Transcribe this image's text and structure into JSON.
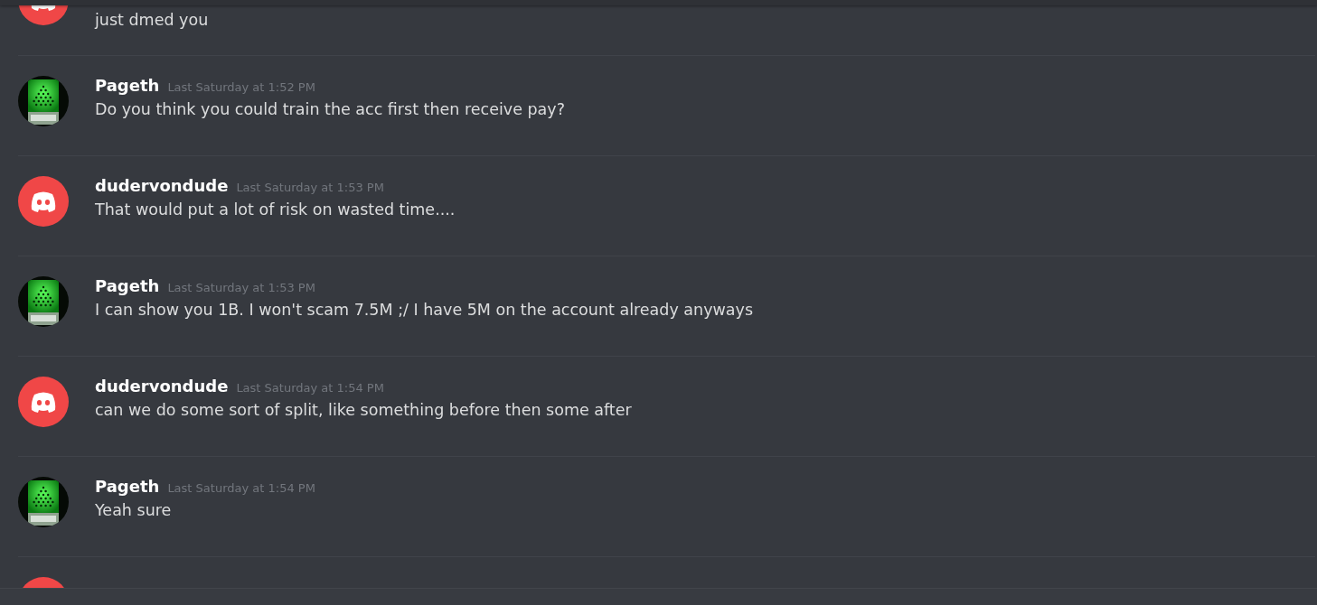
{
  "messages": [
    {
      "kind": "logo",
      "text": "just dmed you"
    },
    {
      "kind": "picture",
      "author": "Pageth",
      "timestamp": "Last Saturday at 1:52 PM",
      "text": "Do you think you could train the acc first then receive pay?"
    },
    {
      "kind": "logo",
      "author": "dudervondude",
      "timestamp": "Last Saturday at 1:53 PM",
      "text": "That would put a lot of risk on wasted time...."
    },
    {
      "kind": "picture",
      "author": "Pageth",
      "timestamp": "Last Saturday at 1:53 PM",
      "text": "I can show you 1B. I won't scam 7.5M ;/ I have 5M on the account already anyways"
    },
    {
      "kind": "logo",
      "author": "dudervondude",
      "timestamp": "Last Saturday at 1:54 PM",
      "text": "can we do some sort of split, like something before then some after"
    },
    {
      "kind": "picture",
      "author": "Pageth",
      "timestamp": "Last Saturday at 1:54 PM",
      "text": "Yeah sure"
    },
    {
      "kind": "logo"
    }
  ]
}
